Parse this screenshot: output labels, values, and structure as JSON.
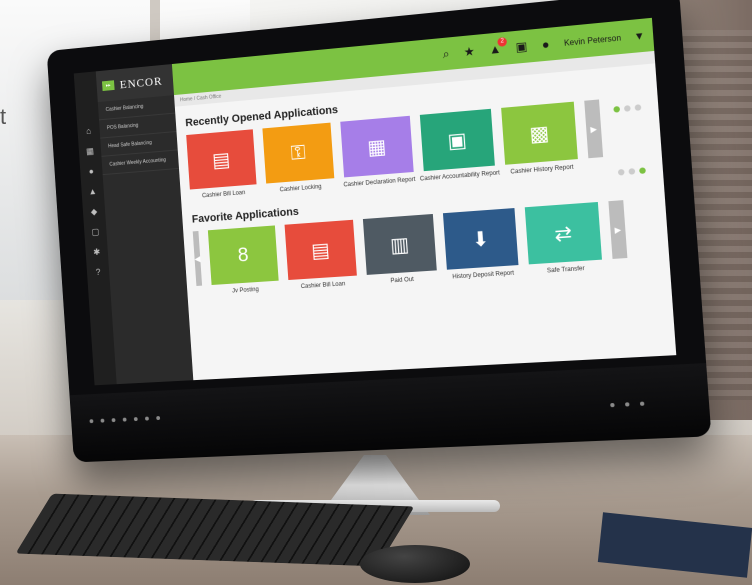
{
  "background": {
    "corner_text": "t"
  },
  "app": {
    "brand_name": "ENCOR",
    "brand_badge": "",
    "breadcrumb": "Home  /  Cash Office",
    "user_name": "Kevin Peterson",
    "notification_count": "2",
    "sidebar_items": [
      "Cashier Balancing",
      "POS Balancing",
      "Head Safe Balancing",
      "Cashier Weekly Accounting"
    ],
    "recent": {
      "title": "Recently Opened Applications",
      "tiles": [
        {
          "label": "Cashier Bill Loan",
          "color": "#e74c3c",
          "icon": "cash-icon",
          "glyph": "▤"
        },
        {
          "label": "Cashier Locking",
          "color": "#f39c12",
          "icon": "lock-icon",
          "glyph": "🔒"
        },
        {
          "label": "Cashier Declaration Report",
          "color": "#a67ee8",
          "icon": "report-icon",
          "glyph": "▦"
        },
        {
          "label": "Cashier Accountability Report",
          "color": "#27a57a",
          "icon": "register-icon",
          "glyph": "▣"
        },
        {
          "label": "Cashier History Report",
          "color": "#8cc63f",
          "icon": "money-icon",
          "glyph": "▩"
        }
      ]
    },
    "favorites": {
      "title": "Favorite Applications",
      "tiles": [
        {
          "label": "Jv Posting",
          "color": "#8cc63f",
          "icon": "pos-icon",
          "glyph": "8"
        },
        {
          "label": "Cashier Bill Loan",
          "color": "#e74c3c",
          "icon": "cash-icon",
          "glyph": "▤"
        },
        {
          "label": "Paid Out",
          "color": "#4f5a63",
          "icon": "money-out-icon",
          "glyph": "▥"
        },
        {
          "label": "History Deposit Report",
          "color": "#2d5a8a",
          "icon": "deposit-icon",
          "glyph": "⬇"
        },
        {
          "label": "Safe Transfer",
          "color": "#3cc0a0",
          "icon": "transfer-icon",
          "glyph": "⇄"
        }
      ]
    }
  }
}
